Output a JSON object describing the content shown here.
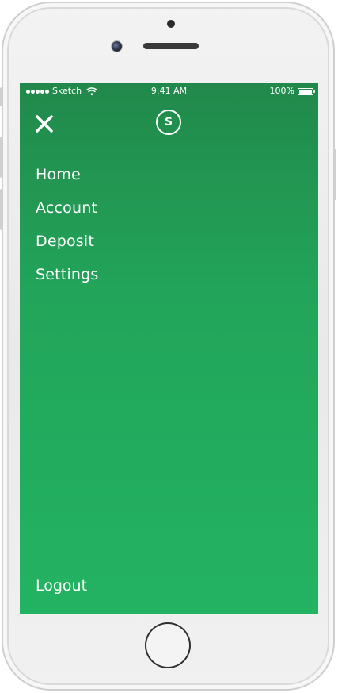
{
  "status_bar": {
    "carrier": "Sketch",
    "time": "9:41 AM",
    "battery": "100%"
  },
  "header": {
    "close_icon": "close-icon",
    "logo_letter": "S"
  },
  "menu": {
    "items": [
      {
        "label": "Home"
      },
      {
        "label": "Account"
      },
      {
        "label": "Deposit"
      },
      {
        "label": "Settings"
      }
    ],
    "logout_label": "Logout"
  },
  "colors": {
    "menu_gradient_top": "#21894b",
    "menu_gradient_bottom": "#23b362",
    "text": "#ffffff"
  }
}
